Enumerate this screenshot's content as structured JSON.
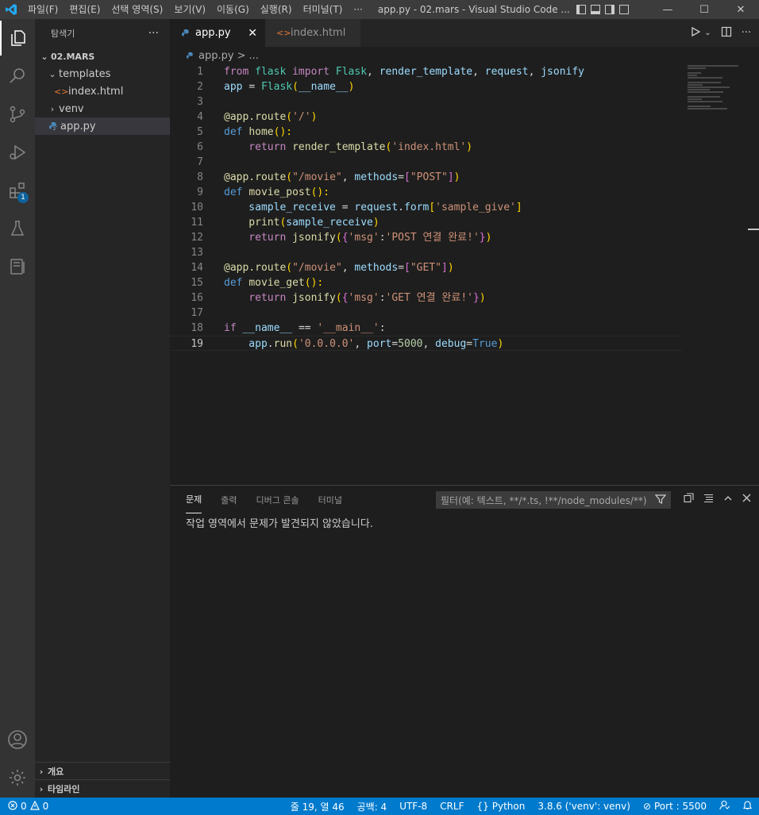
{
  "titlebar": {
    "menu": [
      "파일(F)",
      "편집(E)",
      "선택 영역(S)",
      "보기(V)",
      "이동(G)",
      "실행(R)",
      "터미널(T)",
      "···"
    ],
    "title": "app.py - 02.mars - Visual Studio Code ...",
    "minimize": "—",
    "maximize": "☐",
    "close": "✕"
  },
  "activity": {
    "extensions_badge": "1"
  },
  "sidebar": {
    "title": "탐색기",
    "more": "···",
    "folder": "02.MARS",
    "tree": [
      {
        "label": "templates",
        "type": "folder"
      },
      {
        "label": "index.html",
        "type": "html"
      },
      {
        "label": "venv",
        "type": "folder"
      },
      {
        "label": "app.py",
        "type": "python"
      }
    ],
    "outline": "개요",
    "timeline": "타임라인"
  },
  "tabs": [
    {
      "label": "app.py",
      "close": "✕"
    },
    {
      "label": "index.html"
    }
  ],
  "breadcrumb": {
    "file": "app.py",
    "sep": ">",
    "more": "..."
  },
  "code_lines": [
    {
      "n": "1",
      "tokens": [
        [
          "from ",
          "kw"
        ],
        [
          "flask ",
          "cls"
        ],
        [
          "import ",
          "kw"
        ],
        [
          "Flask",
          "cls"
        ],
        [
          ", ",
          "plain"
        ],
        [
          "render_template",
          "var"
        ],
        [
          ", ",
          "plain"
        ],
        [
          "request",
          "var"
        ],
        [
          ", ",
          "plain"
        ],
        [
          "jsonify",
          "var"
        ]
      ]
    },
    {
      "n": "2",
      "tokens": [
        [
          "app ",
          "var"
        ],
        [
          "= ",
          "plain"
        ],
        [
          "Flask",
          "cls"
        ],
        [
          "(",
          "br1"
        ],
        [
          "__name__",
          "var"
        ],
        [
          ")",
          "br1"
        ]
      ]
    },
    {
      "n": "3",
      "tokens": []
    },
    {
      "n": "4",
      "tokens": [
        [
          "@app.route",
          "fn"
        ],
        [
          "(",
          "br1"
        ],
        [
          "'/'",
          "str"
        ],
        [
          ")",
          "br1"
        ]
      ]
    },
    {
      "n": "5",
      "tokens": [
        [
          "def ",
          "def"
        ],
        [
          "home",
          "fn"
        ],
        [
          "():",
          "br1"
        ]
      ]
    },
    {
      "n": "6",
      "tokens": [
        [
          "    return ",
          "kw"
        ],
        [
          "render_template",
          "fn"
        ],
        [
          "(",
          "br1"
        ],
        [
          "'index.html'",
          "str"
        ],
        [
          ")",
          "br1"
        ]
      ]
    },
    {
      "n": "7",
      "tokens": []
    },
    {
      "n": "8",
      "tokens": [
        [
          "@app.route",
          "fn"
        ],
        [
          "(",
          "br1"
        ],
        [
          "\"/movie\"",
          "str"
        ],
        [
          ", ",
          "plain"
        ],
        [
          "methods",
          "var"
        ],
        [
          "=",
          "plain"
        ],
        [
          "[",
          "br2"
        ],
        [
          "\"POST\"",
          "str"
        ],
        [
          "]",
          "br2"
        ],
        [
          ")",
          "br1"
        ]
      ]
    },
    {
      "n": "9",
      "tokens": [
        [
          "def ",
          "def"
        ],
        [
          "movie_post",
          "fn"
        ],
        [
          "():",
          "br1"
        ]
      ]
    },
    {
      "n": "10",
      "tokens": [
        [
          "    sample_receive ",
          "var"
        ],
        [
          "= ",
          "plain"
        ],
        [
          "request",
          "var"
        ],
        [
          ".",
          "plain"
        ],
        [
          "form",
          "var"
        ],
        [
          "[",
          "br1"
        ],
        [
          "'sample_give'",
          "str"
        ],
        [
          "]",
          "br1"
        ]
      ]
    },
    {
      "n": "11",
      "tokens": [
        [
          "    print",
          "fn"
        ],
        [
          "(",
          "br1"
        ],
        [
          "sample_receive",
          "var"
        ],
        [
          ")",
          "br1"
        ]
      ]
    },
    {
      "n": "12",
      "tokens": [
        [
          "    return ",
          "kw"
        ],
        [
          "jsonify",
          "fn"
        ],
        [
          "(",
          "br1"
        ],
        [
          "{",
          "br2"
        ],
        [
          "'msg'",
          "str"
        ],
        [
          ":",
          "plain"
        ],
        [
          "'POST 연결 완료!'",
          "str"
        ],
        [
          "}",
          "br2"
        ],
        [
          ")",
          "br1"
        ]
      ]
    },
    {
      "n": "13",
      "tokens": []
    },
    {
      "n": "14",
      "tokens": [
        [
          "@app.route",
          "fn"
        ],
        [
          "(",
          "br1"
        ],
        [
          "\"/movie\"",
          "str"
        ],
        [
          ", ",
          "plain"
        ],
        [
          "methods",
          "var"
        ],
        [
          "=",
          "plain"
        ],
        [
          "[",
          "br2"
        ],
        [
          "\"GET\"",
          "str"
        ],
        [
          "]",
          "br2"
        ],
        [
          ")",
          "br1"
        ]
      ]
    },
    {
      "n": "15",
      "tokens": [
        [
          "def ",
          "def"
        ],
        [
          "movie_get",
          "fn"
        ],
        [
          "():",
          "br1"
        ]
      ]
    },
    {
      "n": "16",
      "tokens": [
        [
          "    return ",
          "kw"
        ],
        [
          "jsonify",
          "fn"
        ],
        [
          "(",
          "br1"
        ],
        [
          "{",
          "br2"
        ],
        [
          "'msg'",
          "str"
        ],
        [
          ":",
          "plain"
        ],
        [
          "'GET 연결 완료!'",
          "str"
        ],
        [
          "}",
          "br2"
        ],
        [
          ")",
          "br1"
        ]
      ]
    },
    {
      "n": "17",
      "tokens": []
    },
    {
      "n": "18",
      "tokens": [
        [
          "if ",
          "kw"
        ],
        [
          "__name__ ",
          "var"
        ],
        [
          "== ",
          "plain"
        ],
        [
          "'__main__'",
          "str"
        ],
        [
          ":",
          "plain"
        ]
      ]
    },
    {
      "n": "19",
      "tokens": [
        [
          "    app",
          "var"
        ],
        [
          ".",
          "plain"
        ],
        [
          "run",
          "fn"
        ],
        [
          "(",
          "br1"
        ],
        [
          "'0.0.0.0'",
          "str"
        ],
        [
          ", ",
          "plain"
        ],
        [
          "port",
          "var"
        ],
        [
          "=",
          "plain"
        ],
        [
          "5000",
          "num"
        ],
        [
          ", ",
          "plain"
        ],
        [
          "debug",
          "var"
        ],
        [
          "=",
          "plain"
        ],
        [
          "True",
          "def"
        ],
        [
          ")",
          "br1"
        ]
      ]
    }
  ],
  "panel": {
    "tabs": [
      "문제",
      "출력",
      "디버그 콘솔",
      "터미널"
    ],
    "filter_placeholder": "필터(예: 텍스트, **/*.ts, !**/node_modules/**)",
    "message": "작업 영역에서 문제가 발견되지 않았습니다."
  },
  "statusbar": {
    "errors": "0",
    "warnings": "0",
    "position": "줄 19, 열 46",
    "spaces": "공백: 4",
    "encoding": "UTF-8",
    "eol": "CRLF",
    "language": "Python",
    "interpreter": "3.8.6 ('venv': venv)",
    "port": "Port : 5500"
  },
  "colors": {
    "accent": "#007acc",
    "activity_bar": "#333333",
    "sidebar": "#252526",
    "editor": "#1e1e1e"
  }
}
